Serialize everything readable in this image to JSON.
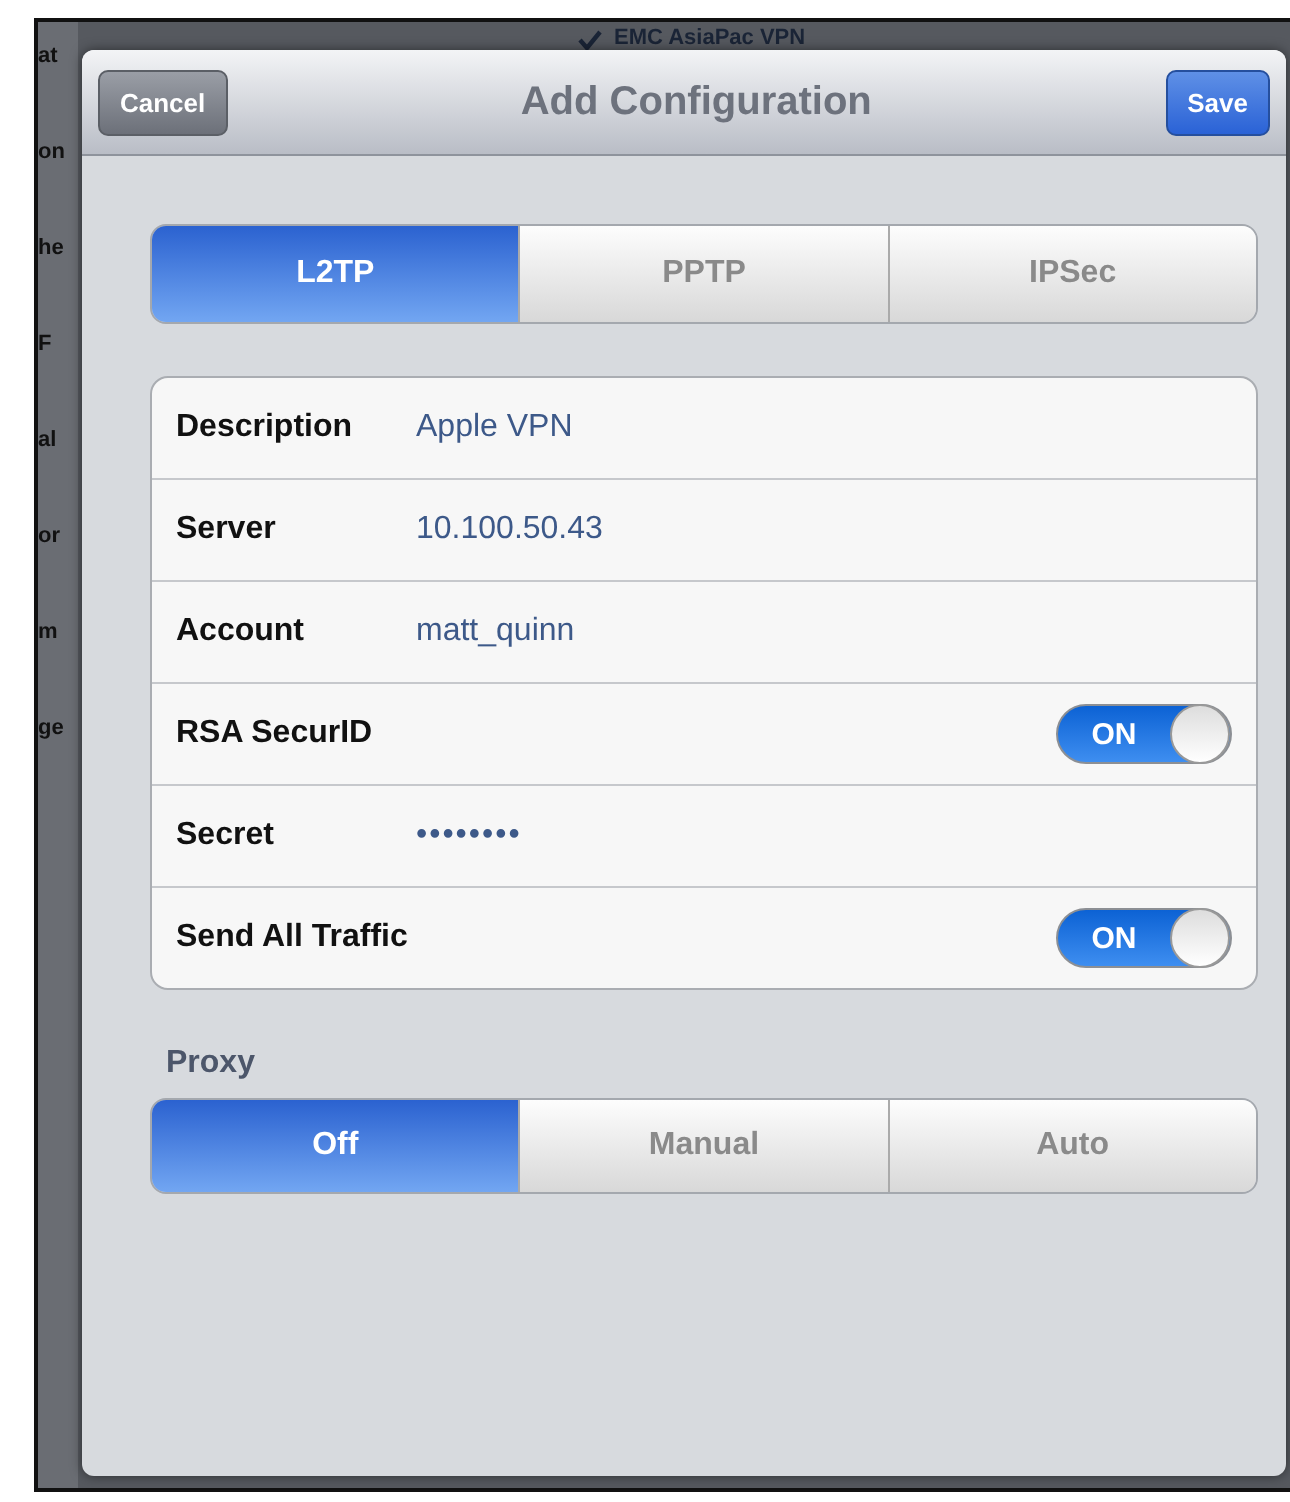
{
  "background": {
    "list_fragments": [
      "at",
      "on",
      "he",
      "F",
      "al",
      "or",
      "m",
      "ge"
    ],
    "checked_item": {
      "label": "EMC AsiaPac VPN",
      "checked": true
    }
  },
  "header": {
    "cancel": "Cancel",
    "title": "Add Configuration",
    "save": "Save"
  },
  "vpn_type": [
    {
      "label": "L2TP",
      "selected": true
    },
    {
      "label": "PPTP",
      "selected": false
    },
    {
      "label": "IPSec",
      "selected": false
    }
  ],
  "fields": [
    {
      "kind": "text",
      "label": "Description",
      "value": "Apple VPN"
    },
    {
      "kind": "text",
      "label": "Server",
      "value": "10.100.50.43"
    },
    {
      "kind": "text",
      "label": "Account",
      "value": "matt_quinn"
    },
    {
      "kind": "toggle",
      "label": "RSA SecurID",
      "on": true,
      "state_label": "ON"
    },
    {
      "kind": "secret",
      "label": "Secret",
      "value": "••••••••"
    },
    {
      "kind": "toggle",
      "label": "Send All Traffic",
      "on": true,
      "state_label": "ON"
    }
  ],
  "proxy": {
    "label": "Proxy",
    "options": [
      {
        "label": "Off",
        "selected": true
      },
      {
        "label": "Manual",
        "selected": false
      },
      {
        "label": "Auto",
        "selected": false
      }
    ]
  }
}
